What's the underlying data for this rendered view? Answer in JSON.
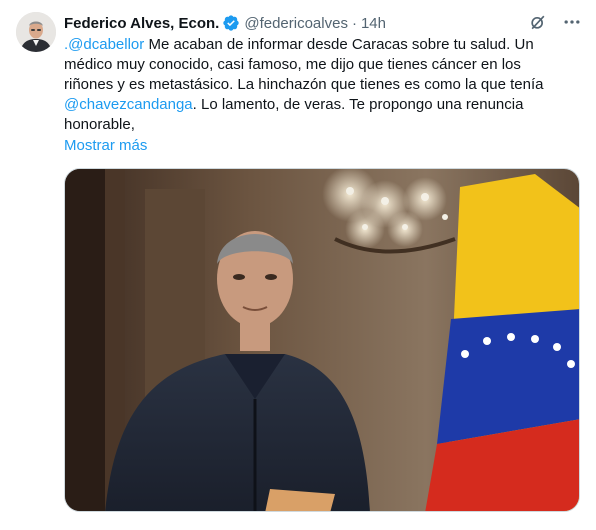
{
  "author": {
    "name": "Federico Alves, Econ.",
    "handle": "@federicoalves",
    "separator": "·",
    "time": "14h"
  },
  "tweet": {
    "line1_mention": ".@dcabellor",
    "line1_text": " Me acaban de informar desde Caracas sobre tu salud. Un médico muy conocido, casi famoso, me dijo que tienes cáncer en los riñones y es metastásico. La hinchazón que tienes es como la que tenía ",
    "mention2": "@chavezcandanga",
    "line_end": ". Lo lamento, de veras. Te propongo una renuncia honorable,",
    "show_more": "Mostrar más"
  },
  "icons": {
    "verified": "verified-badge-icon",
    "grok": "grok-icon",
    "more": "more-options-icon"
  },
  "colors": {
    "link": "#1d9bf0",
    "secondary_text": "#536471",
    "verified": "#1d9bf0"
  }
}
